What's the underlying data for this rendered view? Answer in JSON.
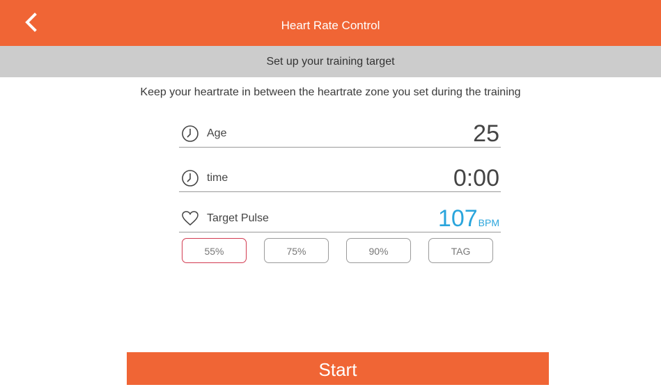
{
  "header": {
    "title": "Heart Rate Control",
    "back_icon": "chevron-left-icon",
    "color": "#f06535"
  },
  "subheader": {
    "text": "Set up your training target"
  },
  "hint": "Keep your heartrate in between the heartrate zone you set during the training",
  "fields": {
    "age": {
      "label": "Age",
      "value": "25",
      "icon": "clock-icon"
    },
    "time": {
      "label": "time",
      "value": "0:00",
      "icon": "clock-icon"
    },
    "pulse": {
      "label": "Target Pulse",
      "value": "107",
      "unit": "BPM",
      "icon": "heart-icon",
      "value_color": "#2aa5dc"
    }
  },
  "presets": [
    {
      "label": "55%",
      "selected": true
    },
    {
      "label": "75%",
      "selected": false
    },
    {
      "label": "90%",
      "selected": false
    },
    {
      "label": "TAG",
      "selected": false
    }
  ],
  "start_label": "Start"
}
